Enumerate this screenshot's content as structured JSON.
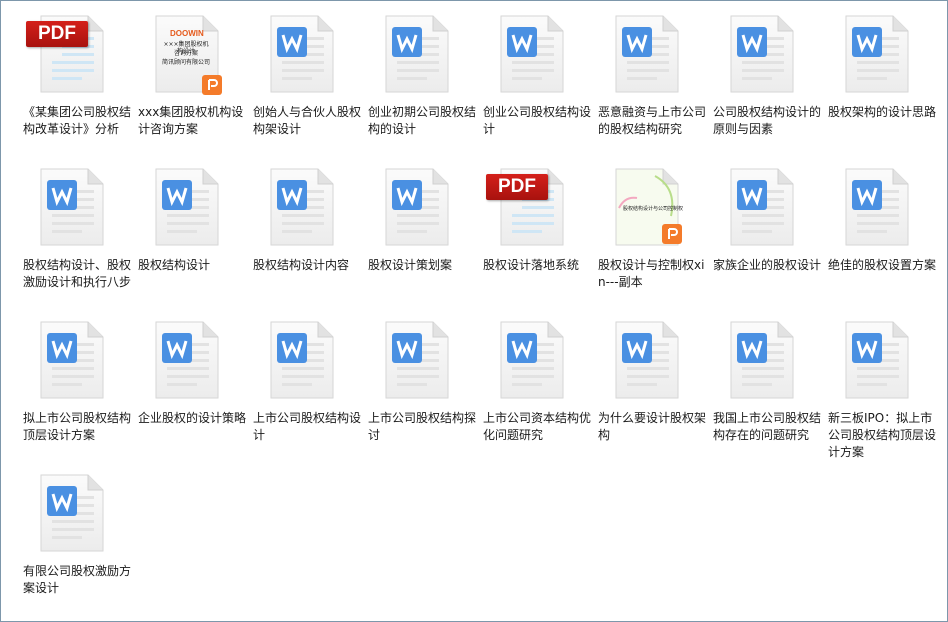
{
  "files": [
    {
      "name": "《某集团公司股权结构改革设计》分析",
      "type": "pdf",
      "icon": "pdf-icon",
      "badge": "PDF"
    },
    {
      "name": "xxx集团股权机构设计咨询方案",
      "type": "ppt-thumb",
      "icon": "presentation-thumbnail-icon",
      "thumb_brand": "DOOWIN",
      "thumb_lines": [
        "×××集团股权机构设计",
        "咨询方案",
        "简讯顾问有限公司"
      ]
    },
    {
      "name": "创始人与合伙人股权构架设计",
      "type": "word",
      "icon": "word-doc-icon"
    },
    {
      "name": "创业初期公司股权结构的设计",
      "type": "word",
      "icon": "word-doc-icon"
    },
    {
      "name": "创业公司股权结构设计",
      "type": "word",
      "icon": "word-doc-icon"
    },
    {
      "name": "恶意融资与上市公司的股权结构研究",
      "type": "word",
      "icon": "word-doc-icon"
    },
    {
      "name": "公司股权结构设计的原则与因素",
      "type": "word",
      "icon": "word-doc-icon"
    },
    {
      "name": "股权架构的设计思路",
      "type": "word",
      "icon": "word-doc-icon"
    },
    {
      "name": "股权结构设计、股权激励设计和执行八步",
      "type": "word",
      "icon": "word-doc-icon"
    },
    {
      "name": "股权结构设计",
      "type": "word",
      "icon": "word-doc-icon"
    },
    {
      "name": "股权结构设计内容",
      "type": "word",
      "icon": "word-doc-icon"
    },
    {
      "name": "股权设计策划案",
      "type": "word",
      "icon": "word-doc-icon"
    },
    {
      "name": "股权设计落地系统",
      "type": "pdf",
      "icon": "pdf-icon",
      "badge": "PDF"
    },
    {
      "name": "股权设计与控制权xin---副本",
      "type": "ppt-thumb2",
      "icon": "presentation-thumbnail-icon",
      "thumb_lines": [
        "股权结构设计与公司控制权"
      ]
    },
    {
      "name": "家族企业的股权设计",
      "type": "word",
      "icon": "word-doc-icon"
    },
    {
      "name": "绝佳的股权设置方案",
      "type": "word",
      "icon": "word-doc-icon"
    },
    {
      "name": "拟上市公司股权结构顶层设计方案",
      "type": "word",
      "icon": "word-doc-icon"
    },
    {
      "name": "企业股权的设计策略",
      "type": "word",
      "icon": "word-doc-icon"
    },
    {
      "name": "上市公司股权结构设计",
      "type": "word",
      "icon": "word-doc-icon"
    },
    {
      "name": "上市公司股权结构探讨",
      "type": "word",
      "icon": "word-doc-icon"
    },
    {
      "name": "上市公司资本结构优化问题研究",
      "type": "word",
      "icon": "word-doc-icon"
    },
    {
      "name": "为什么要设计股权架构",
      "type": "word",
      "icon": "word-doc-icon"
    },
    {
      "name": "我国上市公司股权结构存在的问题研究",
      "type": "word",
      "icon": "word-doc-icon"
    },
    {
      "name": "新三板IPO：拟上市公司股权结构顶层设计方案",
      "type": "word",
      "icon": "word-doc-icon"
    },
    {
      "name": "有限公司股权激励方案设计",
      "type": "word",
      "icon": "word-doc-icon"
    }
  ],
  "colors": {
    "word_blue": "#4a90e2",
    "pdf_red": "#c41a14",
    "ppt_orange": "#f47b2a",
    "border": "#7d97ab"
  }
}
